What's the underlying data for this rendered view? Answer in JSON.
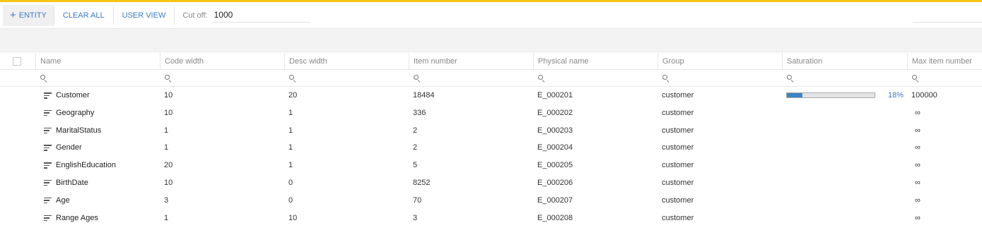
{
  "toolbar": {
    "add_entity_label": "ENTITY",
    "clear_all_label": "CLEAR ALL",
    "user_view_label": "USER VIEW",
    "cutoff_label": "Cut off:",
    "cutoff_value": "1000"
  },
  "columns": [
    "Name",
    "Code width",
    "Desc width",
    "Item number",
    "Physical name",
    "Group",
    "Saturation",
    "Max item number"
  ],
  "rows": [
    {
      "name": "Customer",
      "code_width": "10",
      "desc_width": "20",
      "item_number": "18484",
      "physical_name": "E_000201",
      "group": "customer",
      "saturation": 0.18,
      "saturation_label": "18%",
      "max_item_number": "100000"
    },
    {
      "name": "Geography",
      "code_width": "10",
      "desc_width": "1",
      "item_number": "336",
      "physical_name": "E_000202",
      "group": "customer",
      "saturation": null,
      "saturation_label": "",
      "max_item_number": "∞"
    },
    {
      "name": "MaritalStatus",
      "code_width": "1",
      "desc_width": "1",
      "item_number": "2",
      "physical_name": "E_000203",
      "group": "customer",
      "saturation": null,
      "saturation_label": "",
      "max_item_number": "∞"
    },
    {
      "name": "Gender",
      "code_width": "1",
      "desc_width": "1",
      "item_number": "2",
      "physical_name": "E_000204",
      "group": "customer",
      "saturation": null,
      "saturation_label": "",
      "max_item_number": "∞"
    },
    {
      "name": "EnglishEducation",
      "code_width": "20",
      "desc_width": "1",
      "item_number": "5",
      "physical_name": "E_000205",
      "group": "customer",
      "saturation": null,
      "saturation_label": "",
      "max_item_number": "∞"
    },
    {
      "name": "BirthDate",
      "code_width": "10",
      "desc_width": "0",
      "item_number": "8252",
      "physical_name": "E_000206",
      "group": "customer",
      "saturation": null,
      "saturation_label": "",
      "max_item_number": "∞"
    },
    {
      "name": "Age",
      "code_width": "3",
      "desc_width": "0",
      "item_number": "70",
      "physical_name": "E_000207",
      "group": "customer",
      "saturation": null,
      "saturation_label": "",
      "max_item_number": "∞"
    },
    {
      "name": "Range Ages",
      "code_width": "1",
      "desc_width": "10",
      "item_number": "3",
      "physical_name": "E_000208",
      "group": "customer",
      "saturation": null,
      "saturation_label": "",
      "max_item_number": "∞"
    }
  ],
  "icons": {
    "add": "plus-icon",
    "filter": "search-icon",
    "entity": "entity-list-icon"
  },
  "colors": {
    "accent_line": "#f5c518",
    "link": "#3a7bc8",
    "saturation_fill": "#3a86c6"
  }
}
